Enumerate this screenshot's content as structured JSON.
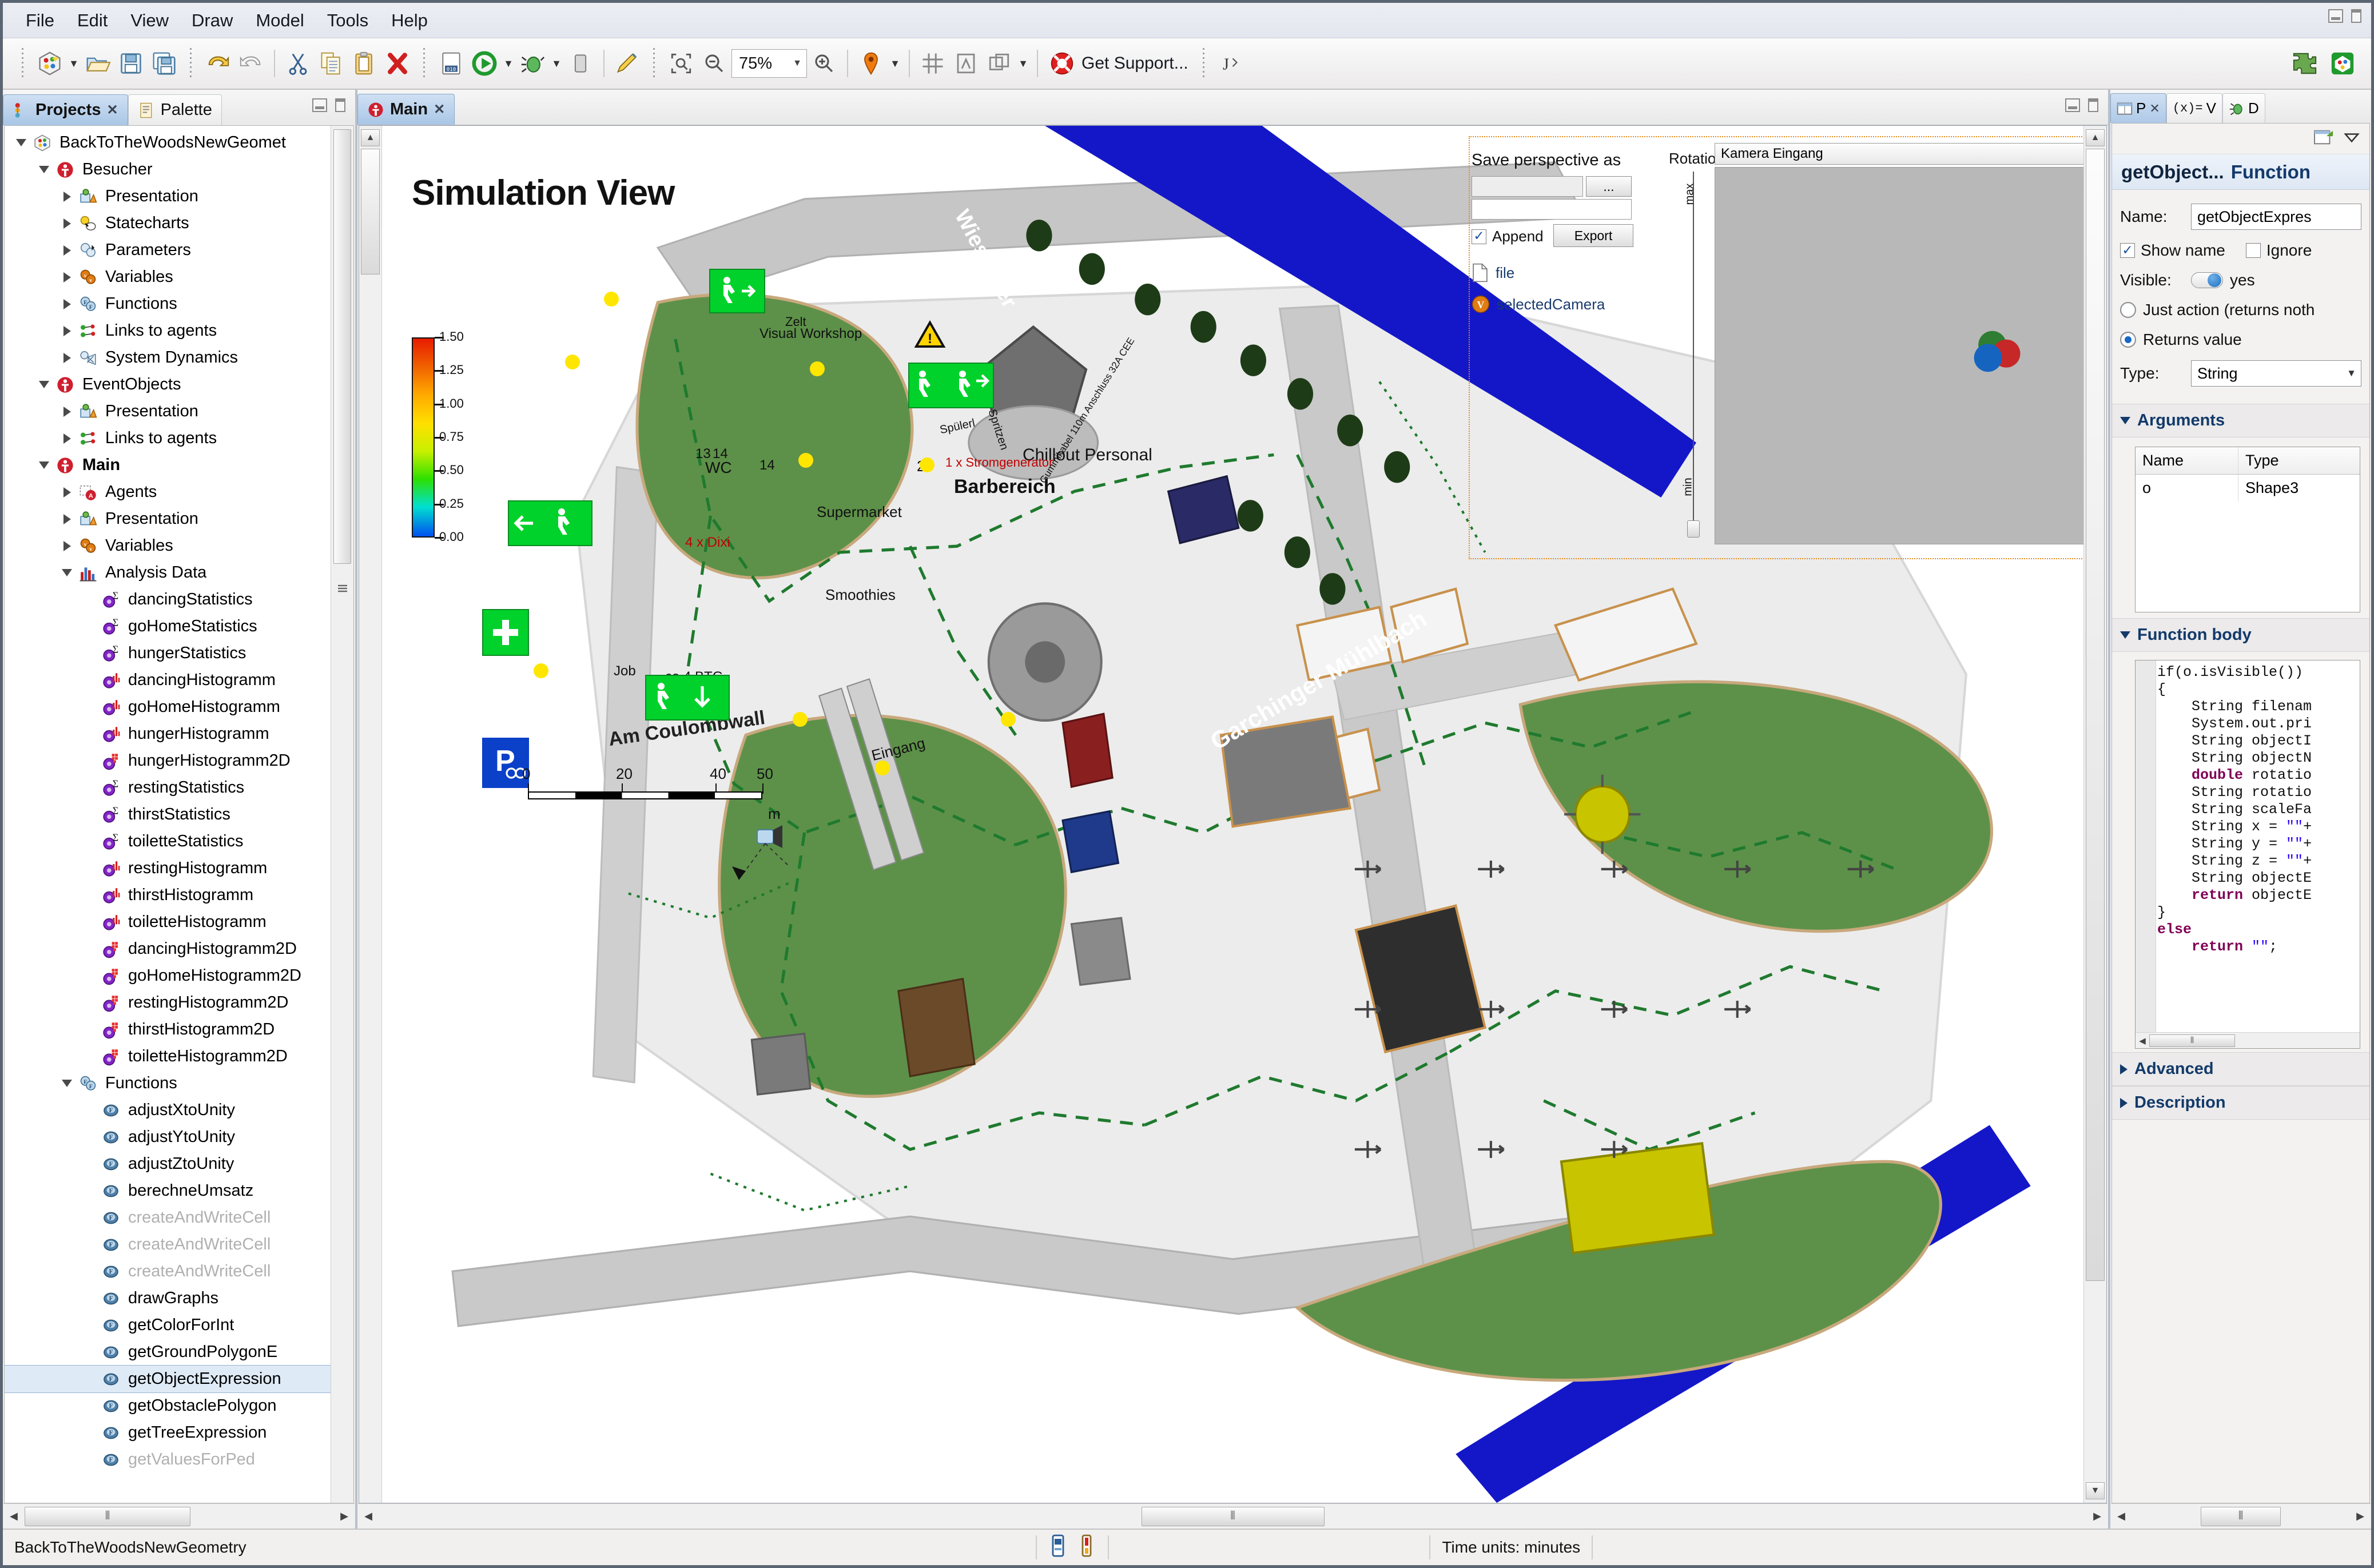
{
  "menu": {
    "items": [
      "File",
      "Edit",
      "View",
      "Draw",
      "Model",
      "Tools",
      "Help"
    ]
  },
  "toolbar": {
    "new_model_label": "new-model",
    "open_label": "open",
    "save_label": "save",
    "save_all_label": "save-all",
    "undo_label": "undo",
    "redo_label": "redo",
    "cut_label": "cut",
    "copy_label": "copy",
    "paste_label": "paste",
    "delete_label": "delete",
    "build_label": "build",
    "run_label": "run",
    "debug_label": "debug",
    "terminate_label": "terminate",
    "pen_label": "pen",
    "zoom_fit_label": "zoom-fit",
    "zoom_out_label": "zoom-out",
    "zoom_value": "75%",
    "zoom_in_label": "zoom-in",
    "marker_label": "marker",
    "grid_label": "grid",
    "snap_label": "snap-to-grid",
    "group_label": "group",
    "support_label": "Get Support...",
    "convert_label": "convert",
    "right_icon_1": "puzzle",
    "right_icon_2": "anylogic-cloud"
  },
  "left_panel": {
    "tabs": [
      {
        "label": "Projects",
        "icon": "projects-icon",
        "active": true,
        "closable": true
      },
      {
        "label": "Palette",
        "icon": "palette-icon",
        "active": false,
        "closable": false
      }
    ],
    "minimize_label": "minimize",
    "maximize_label": "maximize",
    "tree": [
      {
        "depth": 0,
        "label": "BackToTheWoodsNewGeomet",
        "icon": "model-icon",
        "state": "open",
        "bold": false,
        "dim": false
      },
      {
        "depth": 1,
        "label": "Besucher",
        "icon": "agent-icon",
        "state": "open",
        "bold": false,
        "dim": false
      },
      {
        "depth": 2,
        "label": "Presentation",
        "icon": "presentation-icon",
        "state": "closed",
        "bold": false,
        "dim": false
      },
      {
        "depth": 2,
        "label": "Statecharts",
        "icon": "statechart-icon",
        "state": "closed",
        "bold": false,
        "dim": false
      },
      {
        "depth": 2,
        "label": "Parameters",
        "icon": "parameter-icon",
        "state": "closed",
        "bold": false,
        "dim": false
      },
      {
        "depth": 2,
        "label": "Variables",
        "icon": "variable-icon",
        "state": "closed",
        "bold": false,
        "dim": false
      },
      {
        "depth": 2,
        "label": "Functions",
        "icon": "function-icon",
        "state": "closed",
        "bold": false,
        "dim": false
      },
      {
        "depth": 2,
        "label": "Links to agents",
        "icon": "links-icon",
        "state": "closed",
        "bold": false,
        "dim": false
      },
      {
        "depth": 2,
        "label": "System Dynamics",
        "icon": "system-dynamics-icon",
        "state": "closed",
        "bold": false,
        "dim": false
      },
      {
        "depth": 1,
        "label": "EventObjects",
        "icon": "agent-icon",
        "state": "open",
        "bold": false,
        "dim": false
      },
      {
        "depth": 2,
        "label": "Presentation",
        "icon": "presentation-icon",
        "state": "closed",
        "bold": false,
        "dim": false
      },
      {
        "depth": 2,
        "label": "Links to agents",
        "icon": "links-icon",
        "state": "closed",
        "bold": false,
        "dim": false
      },
      {
        "depth": 1,
        "label": "Main",
        "icon": "agent-icon",
        "state": "open",
        "bold": true,
        "dim": false
      },
      {
        "depth": 2,
        "label": "Agents",
        "icon": "agents-icon",
        "state": "closed",
        "bold": false,
        "dim": false
      },
      {
        "depth": 2,
        "label": "Presentation",
        "icon": "presentation-icon",
        "state": "closed",
        "bold": false,
        "dim": false
      },
      {
        "depth": 2,
        "label": "Variables",
        "icon": "variable-icon",
        "state": "closed",
        "bold": false,
        "dim": false
      },
      {
        "depth": 2,
        "label": "Analysis Data",
        "icon": "analysis-data-icon",
        "state": "open",
        "bold": false,
        "dim": false
      },
      {
        "depth": 3,
        "label": "dancingStatistics",
        "icon": "statistics-icon",
        "state": "leaf",
        "bold": false,
        "dim": false
      },
      {
        "depth": 3,
        "label": "goHomeStatistics",
        "icon": "statistics-icon",
        "state": "leaf",
        "bold": false,
        "dim": false
      },
      {
        "depth": 3,
        "label": "hungerStatistics",
        "icon": "statistics-icon",
        "state": "leaf",
        "bold": false,
        "dim": false
      },
      {
        "depth": 3,
        "label": "dancingHistogramm",
        "icon": "histogram-icon",
        "state": "leaf",
        "bold": false,
        "dim": false
      },
      {
        "depth": 3,
        "label": "goHomeHistogramm",
        "icon": "histogram-icon",
        "state": "leaf",
        "bold": false,
        "dim": false
      },
      {
        "depth": 3,
        "label": "hungerHistogramm",
        "icon": "histogram-icon",
        "state": "leaf",
        "bold": false,
        "dim": false
      },
      {
        "depth": 3,
        "label": "hungerHistogramm2D",
        "icon": "histogram2d-icon",
        "state": "leaf",
        "bold": false,
        "dim": false
      },
      {
        "depth": 3,
        "label": "restingStatistics",
        "icon": "statistics-icon",
        "state": "leaf",
        "bold": false,
        "dim": false
      },
      {
        "depth": 3,
        "label": "thirstStatistics",
        "icon": "statistics-icon",
        "state": "leaf",
        "bold": false,
        "dim": false
      },
      {
        "depth": 3,
        "label": "toiletteStatistics",
        "icon": "statistics-icon",
        "state": "leaf",
        "bold": false,
        "dim": false
      },
      {
        "depth": 3,
        "label": "restingHistogramm",
        "icon": "histogram-icon",
        "state": "leaf",
        "bold": false,
        "dim": false
      },
      {
        "depth": 3,
        "label": "thirstHistogramm",
        "icon": "histogram-icon",
        "state": "leaf",
        "bold": false,
        "dim": false
      },
      {
        "depth": 3,
        "label": "toiletteHistogramm",
        "icon": "histogram-icon",
        "state": "leaf",
        "bold": false,
        "dim": false
      },
      {
        "depth": 3,
        "label": "dancingHistogramm2D",
        "icon": "histogram2d-icon",
        "state": "leaf",
        "bold": false,
        "dim": false
      },
      {
        "depth": 3,
        "label": "goHomeHistogramm2D",
        "icon": "histogram2d-icon",
        "state": "leaf",
        "bold": false,
        "dim": false
      },
      {
        "depth": 3,
        "label": "restingHistogramm2D",
        "icon": "histogram2d-icon",
        "state": "leaf",
        "bold": false,
        "dim": false
      },
      {
        "depth": 3,
        "label": "thirstHistogramm2D",
        "icon": "histogram2d-icon",
        "state": "leaf",
        "bold": false,
        "dim": false
      },
      {
        "depth": 3,
        "label": "toiletteHistogramm2D",
        "icon": "histogram2d-icon",
        "state": "leaf",
        "bold": false,
        "dim": false
      },
      {
        "depth": 2,
        "label": "Functions",
        "icon": "function-icon",
        "state": "open",
        "bold": false,
        "dim": false
      },
      {
        "depth": 3,
        "label": "adjustXtoUnity",
        "icon": "fn-icon",
        "state": "leaf",
        "bold": false,
        "dim": false
      },
      {
        "depth": 3,
        "label": "adjustYtoUnity",
        "icon": "fn-icon",
        "state": "leaf",
        "bold": false,
        "dim": false
      },
      {
        "depth": 3,
        "label": "adjustZtoUnity",
        "icon": "fn-icon",
        "state": "leaf",
        "bold": false,
        "dim": false
      },
      {
        "depth": 3,
        "label": "berechneUmsatz",
        "icon": "fn-icon",
        "state": "leaf",
        "bold": false,
        "dim": false
      },
      {
        "depth": 3,
        "label": "createAndWriteCell",
        "icon": "fn-icon",
        "state": "leaf",
        "bold": false,
        "dim": true
      },
      {
        "depth": 3,
        "label": "createAndWriteCell",
        "icon": "fn-icon",
        "state": "leaf",
        "bold": false,
        "dim": true
      },
      {
        "depth": 3,
        "label": "createAndWriteCell",
        "icon": "fn-icon",
        "state": "leaf",
        "bold": false,
        "dim": true
      },
      {
        "depth": 3,
        "label": "drawGraphs",
        "icon": "fn-icon",
        "state": "leaf",
        "bold": false,
        "dim": false
      },
      {
        "depth": 3,
        "label": "getColorForInt",
        "icon": "fn-icon",
        "state": "leaf",
        "bold": false,
        "dim": false
      },
      {
        "depth": 3,
        "label": "getGroundPolygonE",
        "icon": "fn-icon",
        "state": "leaf",
        "bold": false,
        "dim": false
      },
      {
        "depth": 3,
        "label": "getObjectExpression",
        "icon": "fn-icon",
        "state": "leaf",
        "bold": false,
        "dim": false,
        "selected": true
      },
      {
        "depth": 3,
        "label": "getObstaclePolygon",
        "icon": "fn-icon",
        "state": "leaf",
        "bold": false,
        "dim": false
      },
      {
        "depth": 3,
        "label": "getTreeExpression",
        "icon": "fn-icon",
        "state": "leaf",
        "bold": false,
        "dim": false
      },
      {
        "depth": 3,
        "label": "getValuesForPed",
        "icon": "fn-icon",
        "state": "leaf",
        "bold": false,
        "dim": true
      }
    ]
  },
  "editor": {
    "tabs": [
      {
        "label": "Main",
        "icon": "agent-icon",
        "active": true,
        "closable": true
      }
    ],
    "minimize_label": "minimize",
    "maximize_label": "maximize",
    "canvas": {
      "title": "Simulation View",
      "camera_panel": {
        "save_perspective_label": "Save perspective as",
        "browse_button_label": "...",
        "path_value": "",
        "filename_value": "",
        "append_label": "Append",
        "append_checked": true,
        "export_button_label": "Export",
        "file_item_label": "file",
        "selected_camera_label": "selectedCamera",
        "rotation_vertical_label": "RotationVertical",
        "slider_max_label": "max",
        "slider_min_label": "min",
        "camera_select_value": "Kamera Eingang"
      },
      "legend": {
        "ticks": [
          "1.50",
          "1.25",
          "1.00",
          "0.75",
          "0.50",
          "0.25",
          "0.00"
        ]
      },
      "scale_bar": {
        "ticks": [
          "0",
          "20",
          "40",
          "50"
        ],
        "unit": "m"
      },
      "map_labels": [
        {
          "text": "Wiesäcker",
          "kind": "river"
        },
        {
          "text": "Garchinger Mühlbach",
          "kind": "river"
        },
        {
          "text": "Am Coulombwall",
          "kind": "street"
        },
        {
          "text": "Barbereich",
          "kind": "area-big"
        },
        {
          "text": "Chillout Personal",
          "kind": "area"
        },
        {
          "text": "1 x Stromgenerator",
          "kind": "note-red"
        },
        {
          "text": "Visual Workshop",
          "kind": "area"
        },
        {
          "text": "Zelt",
          "kind": "area"
        },
        {
          "text": "Spülerl",
          "kind": "area"
        },
        {
          "text": "Spritzen",
          "kind": "area"
        },
        {
          "text": "Smoothies",
          "kind": "area"
        },
        {
          "text": "Supermarket",
          "kind": "area"
        },
        {
          "text": "WC",
          "kind": "area"
        },
        {
          "text": "4 x Dixi",
          "kind": "note-red"
        },
        {
          "text": "ca.4 BTG",
          "kind": "area"
        },
        {
          "text": "Eingang",
          "kind": "area"
        },
        {
          "text": "Job",
          "kind": "area"
        },
        {
          "text": "13",
          "kind": "num"
        },
        {
          "text": "14",
          "kind": "num"
        },
        {
          "text": "14",
          "kind": "num"
        },
        {
          "text": "2",
          "kind": "num"
        },
        {
          "text": "Gummikabel 110m Anschluss 32A CEE",
          "kind": "area-small"
        }
      ]
    }
  },
  "right_panel": {
    "tabs": [
      {
        "label": "P",
        "icon": "properties-icon",
        "active": true,
        "closable": true
      },
      {
        "label": "V",
        "icon": "variables-view-icon",
        "active": false,
        "closable": false
      },
      {
        "label": "D",
        "icon": "debug-icon",
        "active": false,
        "closable": false
      }
    ],
    "minimize_label": "minimize",
    "maximize_label": "maximize",
    "link_editor_label": "link-editor",
    "view_menu_label": "view-menu",
    "header": {
      "name": "getObject...",
      "type": "Function"
    },
    "fields": {
      "name_label": "Name:",
      "name_value": "getObjectExpres",
      "show_name_label": "Show name",
      "show_name_checked": true,
      "ignore_label": "Ignore",
      "ignore_checked": false,
      "visible_label": "Visible:",
      "visible_value": "yes",
      "just_action_label": "Just action (returns noth",
      "just_action_selected": false,
      "returns_value_label": "Returns value",
      "returns_value_selected": true,
      "type_label": "Type:",
      "type_value": "String"
    },
    "arguments": {
      "section_label": "Arguments",
      "columns": [
        "Name",
        "Type"
      ],
      "rows": [
        [
          "o",
          "Shape3"
        ]
      ]
    },
    "function_body": {
      "section_label": "Function body",
      "lines": [
        [
          {
            "t": "if(o.isVisible())",
            "c": "plain"
          }
        ],
        [
          {
            "t": "{",
            "c": "plain"
          }
        ],
        [
          {
            "t": "    String filenam",
            "c": "plain"
          }
        ],
        [
          {
            "t": "    System.out.pri",
            "c": "plain"
          }
        ],
        [
          {
            "t": "    String objectI",
            "c": "plain"
          }
        ],
        [
          {
            "t": "    String objectN",
            "c": "plain"
          }
        ],
        [
          {
            "t": "    ",
            "c": "plain"
          },
          {
            "t": "double",
            "c": "kw"
          },
          {
            "t": " rotatio",
            "c": "plain"
          }
        ],
        [
          {
            "t": "    String rotatio",
            "c": "plain"
          }
        ],
        [
          {
            "t": "    String scaleFa",
            "c": "plain"
          }
        ],
        [
          {
            "t": "    String x = ",
            "c": "plain"
          },
          {
            "t": "\"\"",
            "c": "str"
          },
          {
            "t": "+",
            "c": "plain"
          }
        ],
        [
          {
            "t": "    String y = ",
            "c": "plain"
          },
          {
            "t": "\"\"",
            "c": "str"
          },
          {
            "t": "+",
            "c": "plain"
          }
        ],
        [
          {
            "t": "    String z = ",
            "c": "plain"
          },
          {
            "t": "\"\"",
            "c": "str"
          },
          {
            "t": "+",
            "c": "plain"
          }
        ],
        [
          {
            "t": "    String objectE",
            "c": "plain"
          }
        ],
        [
          {
            "t": "    ",
            "c": "plain"
          },
          {
            "t": "return",
            "c": "kw"
          },
          {
            "t": " objectE",
            "c": "plain"
          }
        ],
        [
          {
            "t": "}",
            "c": "plain"
          }
        ],
        [
          {
            "t": "else",
            "c": "kw"
          }
        ],
        [
          {
            "t": "    ",
            "c": "plain"
          },
          {
            "t": "return",
            "c": "kw"
          },
          {
            "t": " ",
            "c": "plain"
          },
          {
            "t": "\"\"",
            "c": "str"
          },
          {
            "t": ";",
            "c": "plain"
          }
        ]
      ]
    },
    "advanced_label": "Advanced",
    "description_label": "Description"
  },
  "status_bar": {
    "model_name": "BackToTheWoodsNewGeometry",
    "time_units": "Time units: minutes",
    "icon_1": "console-icon",
    "icon_2": "thermometer-icon"
  }
}
